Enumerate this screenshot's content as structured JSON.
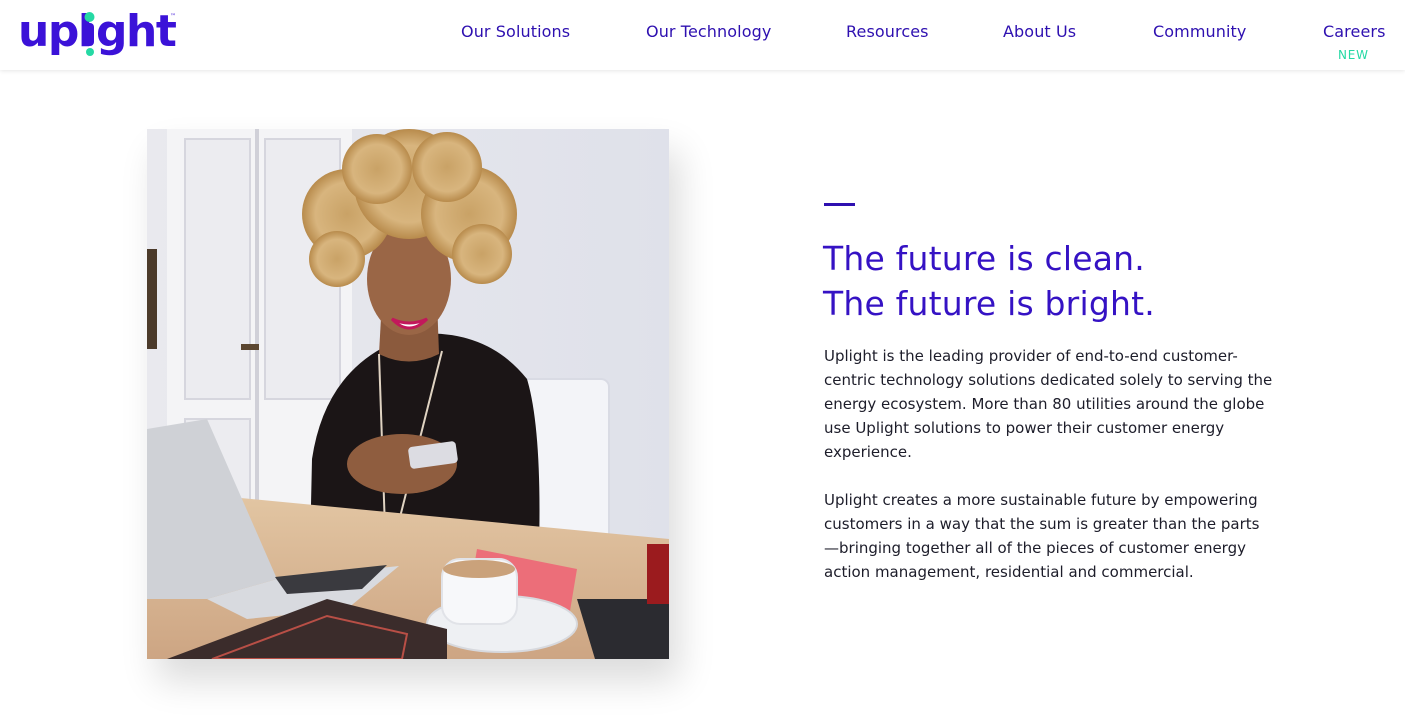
{
  "header": {
    "logo_text": "uplight",
    "nav": [
      {
        "label": "Our Solutions"
      },
      {
        "label": "Our Technology"
      },
      {
        "label": "Resources"
      },
      {
        "label": "About Us"
      },
      {
        "label": "Community"
      },
      {
        "label": "Careers",
        "badge": "NEW"
      }
    ]
  },
  "colors": {
    "brand_purple": "#3512c4",
    "brand_green": "#25d9a4",
    "text_dark": "#1d1d2a"
  },
  "hero": {
    "image_alt_icon": "woman-using-phone-photo",
    "headline_line1": "The future is clean.",
    "headline_line2": "The future is bright.",
    "paragraph1": "Uplight is the leading provider of end-to-end customer-centric technology solutions dedicated solely to serving the energy ecosystem. More than 80 utilities around the globe use Uplight solutions to power their customer energy experience.",
    "paragraph2": "Uplight creates a more sustainable future by empowering customers in a way that the sum is greater than the parts—bringing together all of the pieces of customer energy action management, residential and commercial."
  }
}
